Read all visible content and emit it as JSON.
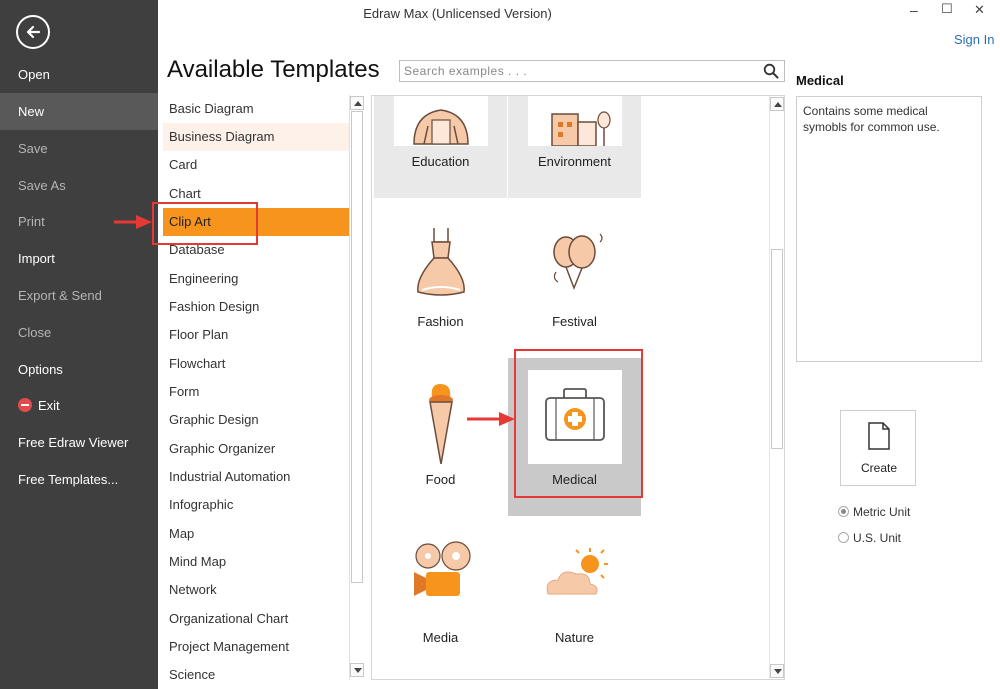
{
  "window": {
    "title": "Edraw Max (Unlicensed Version)",
    "sign_in": "Sign In",
    "minimize_glyph": "–",
    "maximize_glyph": "☐",
    "close_glyph": "✕"
  },
  "sidebar": {
    "items": [
      {
        "label": "Open",
        "state": "normal"
      },
      {
        "label": "New",
        "state": "active"
      },
      {
        "label": "Save",
        "state": "dim"
      },
      {
        "label": "Save As",
        "state": "dim"
      },
      {
        "label": "Print",
        "state": "dim"
      },
      {
        "label": "Import",
        "state": "normal"
      },
      {
        "label": "Export & Send",
        "state": "dim"
      },
      {
        "label": "Close",
        "state": "dim"
      },
      {
        "label": "Options",
        "state": "normal"
      },
      {
        "label": "Exit",
        "state": "normal"
      },
      {
        "label": "Free Edraw Viewer",
        "state": "normal"
      },
      {
        "label": "Free Templates...",
        "state": "normal"
      }
    ]
  },
  "main": {
    "page_title": "Available Templates",
    "search_placeholder": "Search examples . . ."
  },
  "categories": [
    "Basic Diagram",
    "Business Diagram",
    "Card",
    "Chart",
    "Clip Art",
    "Database",
    "Engineering",
    "Fashion Design",
    "Floor Plan",
    "Flowchart",
    "Form",
    "Graphic Design",
    "Graphic Organizer",
    "Industrial Automation",
    "Infographic",
    "Map",
    "Mind Map",
    "Network",
    "Organizational Chart",
    "Project Management",
    "Science"
  ],
  "selected_category": "Clip Art",
  "templates": [
    {
      "label": "Education",
      "icon": "education-icon"
    },
    {
      "label": "Environment",
      "icon": "environment-icon"
    },
    {
      "label": "Fashion",
      "icon": "dress-icon"
    },
    {
      "label": "Festival",
      "icon": "balloons-icon"
    },
    {
      "label": "Food",
      "icon": "ice-cream-icon"
    },
    {
      "label": "Medical",
      "icon": "medical-kit-icon"
    },
    {
      "label": "Media",
      "icon": "film-camera-icon"
    },
    {
      "label": "Nature",
      "icon": "sun-cloud-icon"
    }
  ],
  "selected_template": "Medical",
  "right_panel": {
    "title": "Medical",
    "description": "Contains some medical symobls for common use.",
    "create_label": "Create",
    "units": [
      {
        "label": "Metric Unit",
        "checked": true
      },
      {
        "label": "U.S. Unit",
        "checked": false
      }
    ]
  },
  "colors": {
    "sidebar_bg": "#3f3f3f",
    "accent_orange": "#f7941d",
    "icon_peach": "#f6c9a9",
    "annotation_red": "#e53935",
    "link_blue": "#2a6ebb"
  }
}
